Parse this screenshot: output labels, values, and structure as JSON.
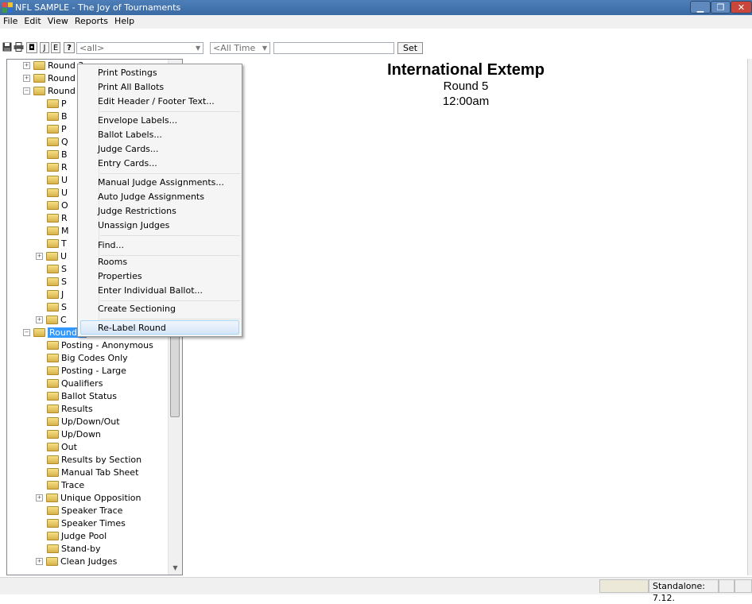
{
  "window": {
    "title": "NFL SAMPLE - The Joy of Tournaments"
  },
  "menu": [
    "File",
    "Edit",
    "View",
    "Reports",
    "Help"
  ],
  "toolbar": {
    "buttons": [
      "J",
      "E",
      "?"
    ],
    "combo_all": "<all>",
    "combo_time": "<All Time",
    "text_value": "",
    "set_label": "Set"
  },
  "tree": {
    "top": [
      {
        "label": "Round 3",
        "type": "expand-plus"
      },
      {
        "label": "Round 4",
        "type": "expand-plus"
      },
      {
        "label": "Round",
        "type": "expand-minus"
      }
    ],
    "hidden_children": [
      "P",
      "B",
      "P",
      "Q",
      "B",
      "R",
      "U",
      "U",
      "O",
      "R",
      "M",
      "T",
      "U",
      "S",
      "S",
      "J",
      "S",
      "C"
    ],
    "selected": "Round 5",
    "round5_children": [
      "Posting - Anonymous",
      "Big Codes Only",
      "Posting - Large",
      "Qualifiers",
      "Ballot Status",
      "Results",
      "Up/Down/Out",
      "Up/Down",
      "Out",
      "Results by Section",
      "Manual Tab Sheet",
      "Trace",
      "Unique Opposition",
      "Speaker Trace",
      "Speaker Times",
      "Judge Pool",
      "Stand-by",
      "Clean Judges"
    ]
  },
  "report": {
    "title": "International Extemp",
    "round": "Round 5",
    "time": "12:00am"
  },
  "context_menu": {
    "groups": [
      [
        "Print Postings",
        "Print All Ballots",
        "Edit Header / Footer Text..."
      ],
      [
        "Envelope Labels...",
        "Ballot Labels...",
        "Judge Cards...",
        "Entry Cards..."
      ],
      [
        "Manual Judge Assignments...",
        "Auto Judge Assignments",
        "Judge Restrictions",
        "Unassign Judges"
      ],
      [
        "Find..."
      ],
      [
        "Rooms",
        "Properties",
        "Enter Individual Ballot..."
      ],
      [
        "Create Sectioning"
      ],
      [
        "Re-Label Round"
      ]
    ],
    "hovered": "Re-Label Round"
  },
  "status": {
    "version": "Standalone: 7.12."
  },
  "colors": {
    "titlebar": "#3a6aa4",
    "selection": "#3399ff",
    "close": "#c8473a"
  }
}
